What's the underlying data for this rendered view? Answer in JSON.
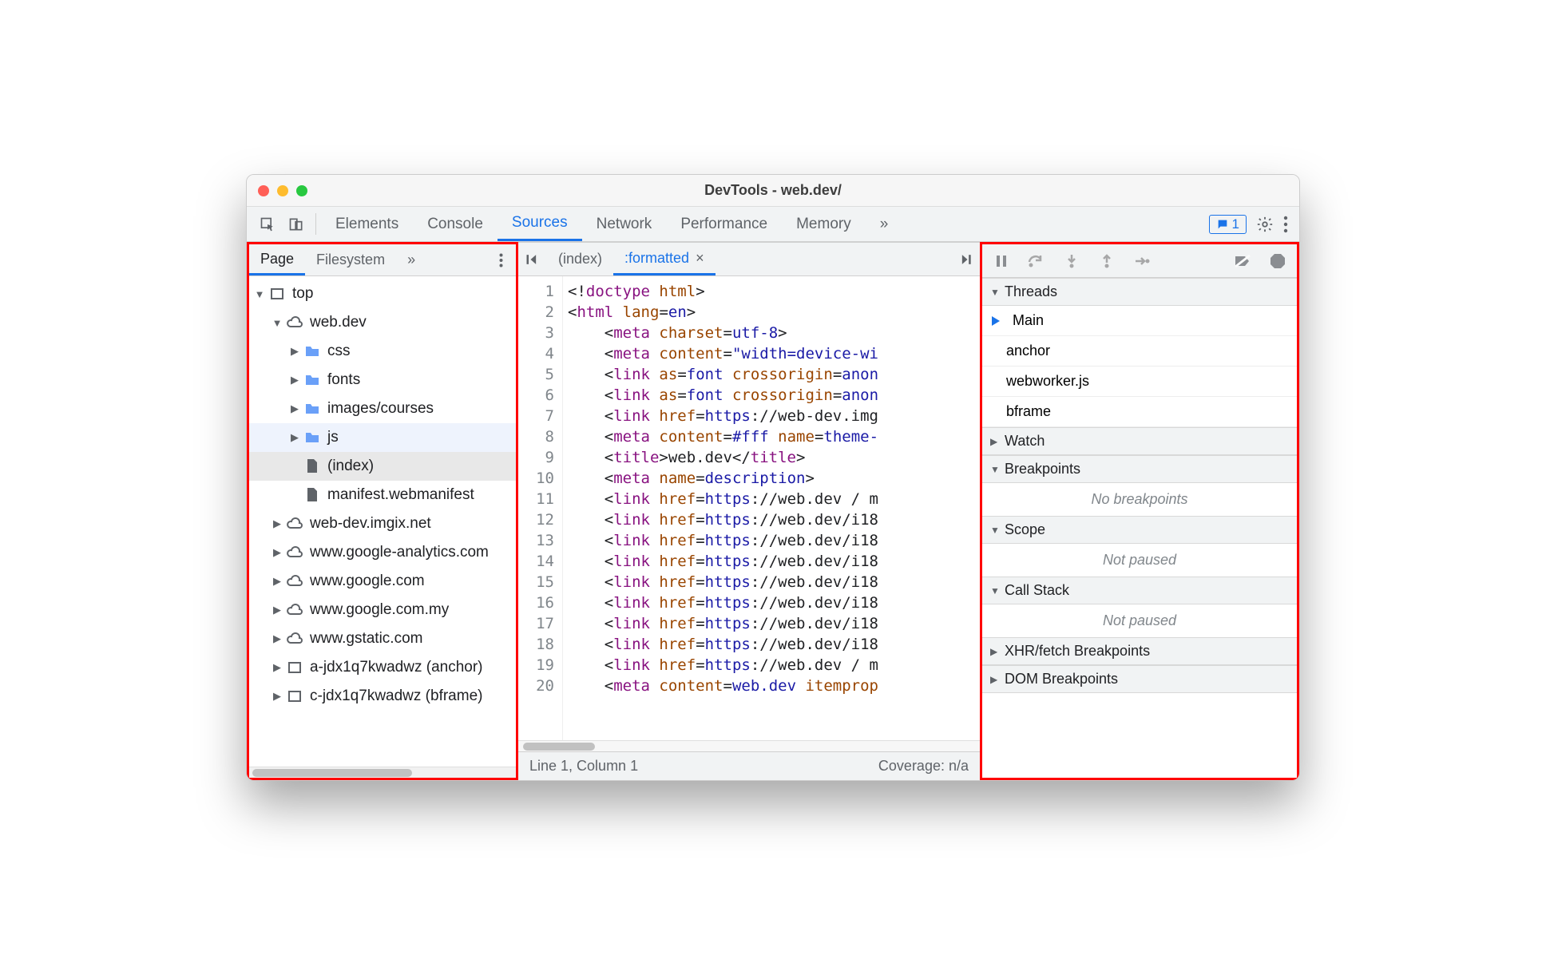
{
  "window": {
    "title": "DevTools - web.dev/"
  },
  "mainTabs": {
    "items": [
      "Elements",
      "Console",
      "Sources",
      "Network",
      "Performance",
      "Memory"
    ],
    "active": "Sources",
    "badgeCount": "1"
  },
  "leftTabs": {
    "items": [
      "Page",
      "Filesystem"
    ],
    "active": "Page"
  },
  "tree": [
    {
      "depth": 0,
      "expand": "down",
      "icon": "frame",
      "label": "top"
    },
    {
      "depth": 1,
      "expand": "down",
      "icon": "cloud",
      "label": "web.dev"
    },
    {
      "depth": 2,
      "expand": "right",
      "icon": "folder",
      "label": "css"
    },
    {
      "depth": 2,
      "expand": "right",
      "icon": "folder",
      "label": "fonts"
    },
    {
      "depth": 2,
      "expand": "right",
      "icon": "folder",
      "label": "images/courses"
    },
    {
      "depth": 2,
      "expand": "right",
      "icon": "folder",
      "label": "js",
      "hover": true
    },
    {
      "depth": 2,
      "expand": "none",
      "icon": "file",
      "label": "(index)",
      "selected": true
    },
    {
      "depth": 2,
      "expand": "none",
      "icon": "file",
      "label": "manifest.webmanifest"
    },
    {
      "depth": 1,
      "expand": "right",
      "icon": "cloud",
      "label": "web-dev.imgix.net"
    },
    {
      "depth": 1,
      "expand": "right",
      "icon": "cloud",
      "label": "www.google-analytics.com"
    },
    {
      "depth": 1,
      "expand": "right",
      "icon": "cloud",
      "label": "www.google.com"
    },
    {
      "depth": 1,
      "expand": "right",
      "icon": "cloud",
      "label": "www.google.com.my"
    },
    {
      "depth": 1,
      "expand": "right",
      "icon": "cloud",
      "label": "www.gstatic.com"
    },
    {
      "depth": 1,
      "expand": "right",
      "icon": "frame",
      "label": "a-jdx1q7kwadwz (anchor)"
    },
    {
      "depth": 1,
      "expand": "right",
      "icon": "frame",
      "label": "c-jdx1q7kwadwz (bframe)"
    }
  ],
  "editorTabs": {
    "items": [
      {
        "label": "(index)",
        "active": false
      },
      {
        "label": ":formatted",
        "active": true,
        "closeable": true
      }
    ]
  },
  "code": [
    {
      "n": 1,
      "html": "&lt;!<span class='tok-tag'>doctype</span> <span class='tok-attr'>html</span>&gt;"
    },
    {
      "n": 2,
      "html": "&lt;<span class='tok-tag'>html</span> <span class='tok-attr'>lang</span>=<span class='tok-val'>en</span>&gt;"
    },
    {
      "n": 3,
      "html": "    &lt;<span class='tok-tag'>meta</span> <span class='tok-attr'>charset</span>=<span class='tok-val'>utf-8</span>&gt;"
    },
    {
      "n": 4,
      "html": "    &lt;<span class='tok-tag'>meta</span> <span class='tok-attr'>content</span>=<span class='tok-str'>\"width=device-wi</span>"
    },
    {
      "n": 5,
      "html": "    &lt;<span class='tok-tag'>link</span> <span class='tok-attr'>as</span>=<span class='tok-val'>font</span> <span class='tok-attr'>crossorigin</span>=<span class='tok-val'>anon</span>"
    },
    {
      "n": 6,
      "html": "    &lt;<span class='tok-tag'>link</span> <span class='tok-attr'>as</span>=<span class='tok-val'>font</span> <span class='tok-attr'>crossorigin</span>=<span class='tok-val'>anon</span>"
    },
    {
      "n": 7,
      "html": "    &lt;<span class='tok-tag'>link</span> <span class='tok-attr'>href</span>=<span class='tok-val'>https</span>://web-dev.img"
    },
    {
      "n": 8,
      "html": "    &lt;<span class='tok-tag'>meta</span> <span class='tok-attr'>content</span>=<span class='tok-val'>#fff</span> <span class='tok-attr'>name</span>=<span class='tok-val'>theme-</span>"
    },
    {
      "n": 9,
      "html": "    &lt;<span class='tok-tag'>title</span>&gt;web.dev&lt;/<span class='tok-tag'>title</span>&gt;"
    },
    {
      "n": 10,
      "html": "    &lt;<span class='tok-tag'>meta</span> <span class='tok-attr'>name</span>=<span class='tok-val'>description</span>&gt;"
    },
    {
      "n": 11,
      "html": "    &lt;<span class='tok-tag'>link</span> <span class='tok-attr'>href</span>=<span class='tok-val'>https</span>://web.dev / m"
    },
    {
      "n": 12,
      "html": "    &lt;<span class='tok-tag'>link</span> <span class='tok-attr'>href</span>=<span class='tok-val'>https</span>://web.dev/i18"
    },
    {
      "n": 13,
      "html": "    &lt;<span class='tok-tag'>link</span> <span class='tok-attr'>href</span>=<span class='tok-val'>https</span>://web.dev/i18"
    },
    {
      "n": 14,
      "html": "    &lt;<span class='tok-tag'>link</span> <span class='tok-attr'>href</span>=<span class='tok-val'>https</span>://web.dev/i18"
    },
    {
      "n": 15,
      "html": "    &lt;<span class='tok-tag'>link</span> <span class='tok-attr'>href</span>=<span class='tok-val'>https</span>://web.dev/i18"
    },
    {
      "n": 16,
      "html": "    &lt;<span class='tok-tag'>link</span> <span class='tok-attr'>href</span>=<span class='tok-val'>https</span>://web.dev/i18"
    },
    {
      "n": 17,
      "html": "    &lt;<span class='tok-tag'>link</span> <span class='tok-attr'>href</span>=<span class='tok-val'>https</span>://web.dev/i18"
    },
    {
      "n": 18,
      "html": "    &lt;<span class='tok-tag'>link</span> <span class='tok-attr'>href</span>=<span class='tok-val'>https</span>://web.dev/i18"
    },
    {
      "n": 19,
      "html": "    &lt;<span class='tok-tag'>link</span> <span class='tok-attr'>href</span>=<span class='tok-val'>https</span>://web.dev / m"
    },
    {
      "n": 20,
      "html": "    &lt;<span class='tok-tag'>meta</span> <span class='tok-attr'>content</span>=<span class='tok-val'>web.dev</span> <span class='tok-attr'>itemprop</span>"
    }
  ],
  "status": {
    "left": "Line 1, Column 1",
    "right": "Coverage: n/a"
  },
  "debugger": {
    "threads": {
      "label": "Threads",
      "expanded": true,
      "items": [
        "Main",
        "anchor",
        "webworker.js",
        "bframe"
      ],
      "current": "Main"
    },
    "watch": {
      "label": "Watch",
      "expanded": false
    },
    "breakpoints": {
      "label": "Breakpoints",
      "expanded": true,
      "empty": "No breakpoints"
    },
    "scope": {
      "label": "Scope",
      "expanded": true,
      "empty": "Not paused"
    },
    "callstack": {
      "label": "Call Stack",
      "expanded": true,
      "empty": "Not paused"
    },
    "xhr": {
      "label": "XHR/fetch Breakpoints",
      "expanded": false
    },
    "dom": {
      "label": "DOM Breakpoints",
      "expanded": false
    }
  }
}
